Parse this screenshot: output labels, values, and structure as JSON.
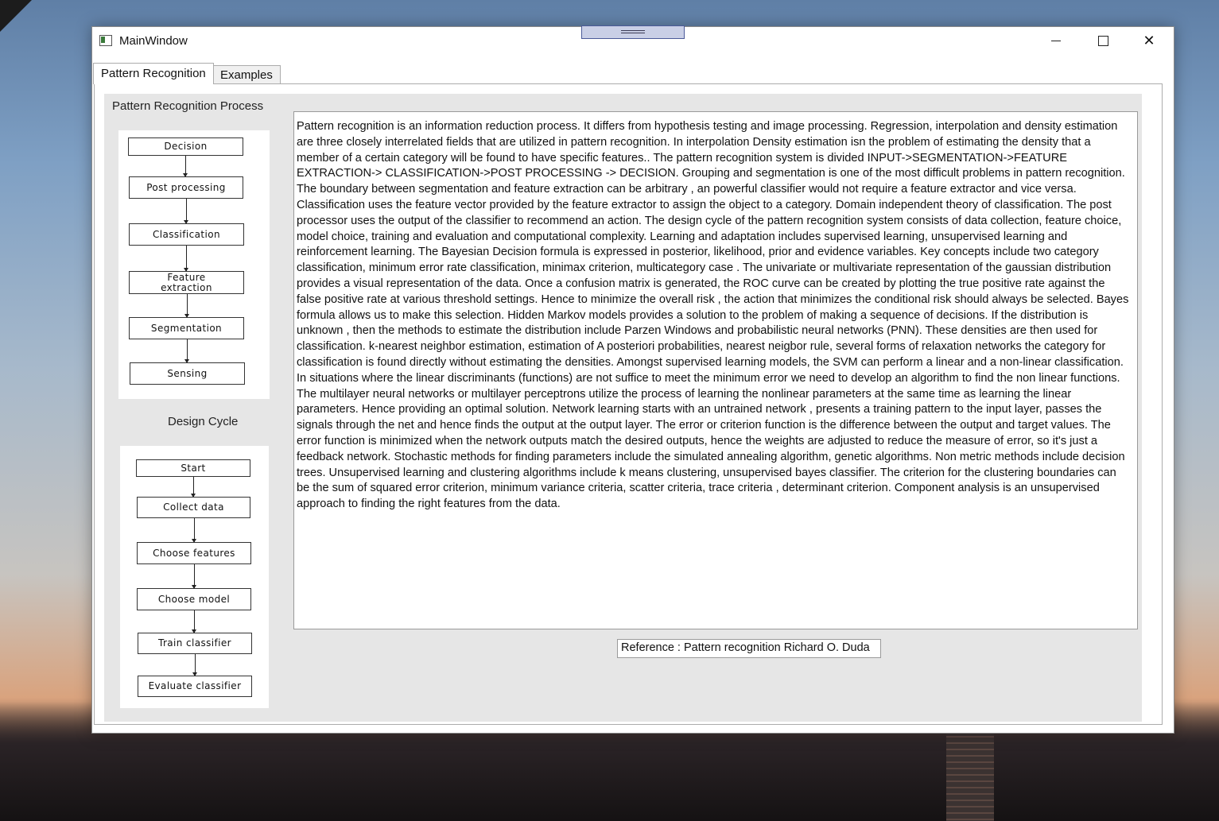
{
  "window": {
    "title": "MainWindow",
    "controls": {
      "minimize": "minimize",
      "maximize": "maximize",
      "close": "close"
    }
  },
  "tabs": [
    {
      "label": "Pattern Recognition",
      "active": true
    },
    {
      "label": "Examples",
      "active": false
    }
  ],
  "process": {
    "title": "Pattern Recognition Process",
    "steps": [
      "Decision",
      "Post processing",
      "Classification",
      "Feature extraction",
      "Segmentation",
      "Sensing"
    ]
  },
  "design_cycle": {
    "title": "Design Cycle",
    "steps": [
      "Start",
      "Collect data",
      "Choose features",
      "Choose model",
      "Train classifier",
      "Evaluate classifier"
    ]
  },
  "description": "Pattern recognition is an information reduction process. It differs from hypothesis testing and image processing. Regression, interpolation and density estimation are three closely interrelated fields that are utilized in pattern recognition. In interpolation Density estimation isn the problem of estimating the density that a member of a certain category will be found to have specific features.. The pattern recognition system is divided  INPUT->SEGMENTATION->FEATURE EXTRACTION-> CLASSIFICATION->POST PROCESSING -> DECISION. Grouping and segmentation is one of the most difficult problems in pattern recognition. The boundary between segmentation and feature extraction can be arbitrary , an powerful classifier would not require a feature extractor and vice versa.   Classification uses the feature vector provided by the feature extractor to assign the object to a category. Domain independent theory of classification. The post processor uses the output of the classifier to recommend an action. The design cycle of the pattern recognition system consists of data collection, feature choice, model choice, training and evaluation and computational complexity. Learning and adaptation includes supervised learning, unsupervised learning and reinforcement learning.  The Bayesian Decision formula is expressed in posterior, likelihood, prior and evidence variables. Key concepts include two category classification, minimum error rate classification, minimax criterion, multicategory case . The univariate or multivariate representation of the gaussian distribution provides a visual representation of the data. Once a confusion matrix is generated, the ROC curve can be created by plotting the true positive rate against the false positive rate at various threshold settings. Hence to minimize the overall risk , the action that minimizes the conditional risk should always be selected. Bayes formula allows us to make this selection. Hidden Markov models provides a solution to the problem of making a sequence of decisions.   If the distribution is unknown , then the methods to estimate the distribution include Parzen Windows and  probabilistic neural networks (PNN). These densities are then used for classification. k-nearest neighbor estimation, estimation of A posteriori probabilities, nearest neigbor rule, several forms of relaxation networks the category for classification is found directly without estimating the densities.   Amongst supervised learning models, the SVM can perform a linear and a non-linear classification.        In situations where the linear discriminants (functions) are not suffice to meet the  minimum error we need to develop an algorithm to find the non linear functions.  The multilayer neural networks or multilayer perceptrons utilize the process of learning the nonlinear parameters at the same time as learning the linear parameters.  Hence providing an optimal solution.    Network learning starts with an untrained network , presents a training pattern to the input layer, passes the signals through the net and hence finds the output at the output layer. The error or criterion function is the difference between the output and target values.  The error function is minimized when the network outputs match the desired outputs, hence the weights are adjusted to reduce the measure of error, so it's just a feedback network.    Stochastic methods for finding parameters include the simulated annealing algorithm, genetic algorithms. Non metric methods include decision trees.  Unsupervised learning  and clustering  algorithms include k means clustering, unsupervised bayes classifier. The criterion for the clustering boundaries can be the sum of squared error criterion, minimum variance criteria, scatter criteria, trace criteria , determinant criterion.  Component analysis is an unsupervised approach to finding the right features from the data.",
  "reference": "Reference : Pattern recognition Richard O. Duda"
}
